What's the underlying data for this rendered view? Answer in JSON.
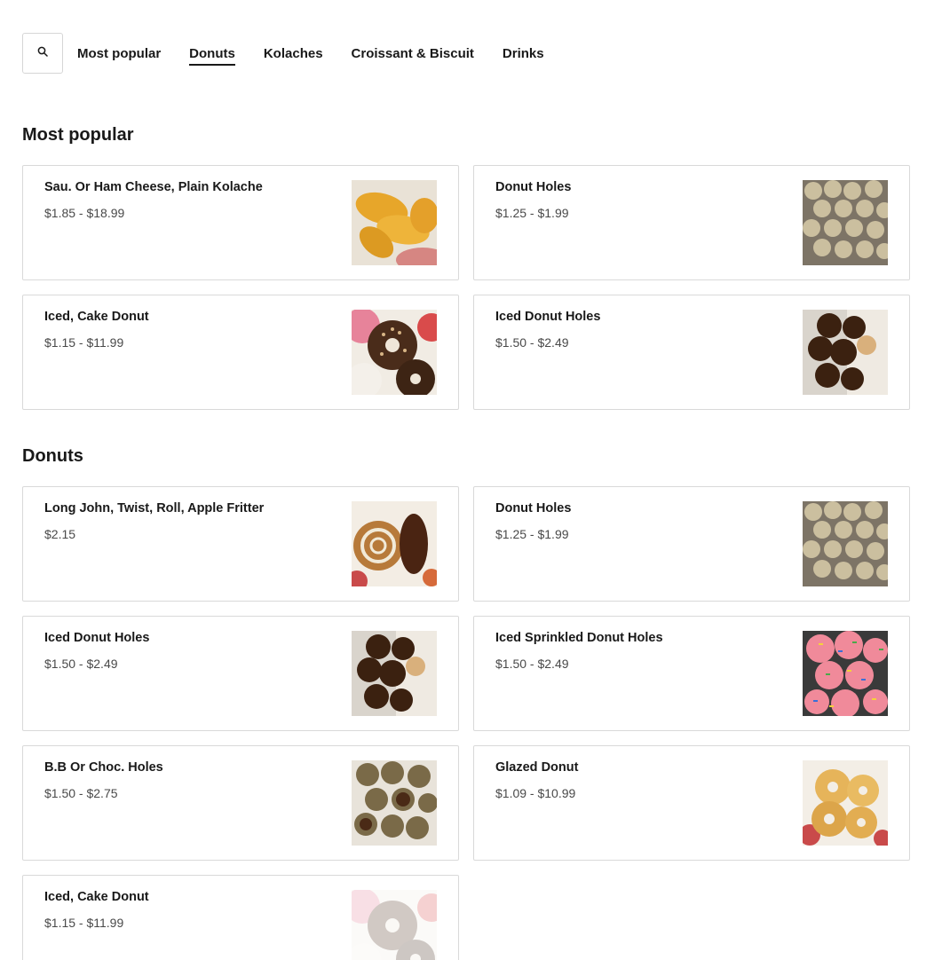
{
  "nav": {
    "search_icon": "search-icon",
    "tabs": [
      {
        "label": "Most popular",
        "active": false
      },
      {
        "label": "Donuts",
        "active": true
      },
      {
        "label": "Kolaches",
        "active": false
      },
      {
        "label": "Croissant & Biscuit",
        "active": false
      },
      {
        "label": "Drinks",
        "active": false
      }
    ]
  },
  "sections": {
    "popular": {
      "title": "Most popular",
      "items": [
        {
          "name": "Sau. Or Ham Cheese, Plain Kolache",
          "price": "$1.85 - $18.99",
          "image": "kolache-photo"
        },
        {
          "name": "Donut Holes",
          "price": "$1.25 - $1.99",
          "image": "donut-holes-photo"
        },
        {
          "name": "Iced, Cake Donut",
          "price": "$1.15 - $11.99",
          "image": "cake-donut-photo"
        },
        {
          "name": "Iced Donut Holes",
          "price": "$1.50 - $2.49",
          "image": "iced-donut-holes-photo"
        }
      ]
    },
    "donuts": {
      "title": "Donuts",
      "items": [
        {
          "name": "Long John, Twist, Roll, Apple Fritter",
          "price": "$2.15",
          "image": "long-john-photo"
        },
        {
          "name": "Donut Holes",
          "price": "$1.25 - $1.99",
          "image": "donut-holes-photo"
        },
        {
          "name": "Iced Donut Holes",
          "price": "$1.50 - $2.49",
          "image": "iced-donut-holes-photo"
        },
        {
          "name": "Iced Sprinkled Donut Holes",
          "price": "$1.50 - $2.49",
          "image": "sprinkled-donut-holes-photo"
        },
        {
          "name": "B.B Or Choc. Holes",
          "price": "$1.50 - $2.75",
          "image": "bb-choc-holes-photo"
        },
        {
          "name": "Glazed Donut",
          "price": "$1.09 - $10.99",
          "image": "glazed-donut-photo"
        },
        {
          "name": "Iced, Cake Donut",
          "price": "$1.15 - $11.99",
          "image": "cake-donut-photo"
        }
      ]
    }
  },
  "colors": {
    "text": "#191919",
    "price": "#494949",
    "border": "#d9d9d9"
  }
}
